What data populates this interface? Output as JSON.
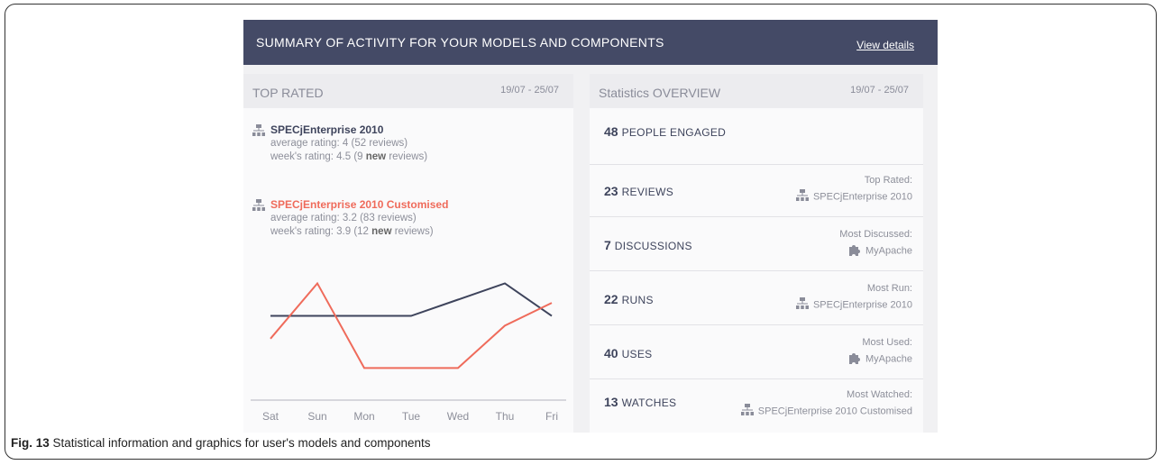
{
  "header": {
    "title": "SUMMARY OF ACTIVITY FOR YOUR MODELS AND COMPONENTS",
    "details_link": "View details"
  },
  "top_rated": {
    "title": "TOP RATED",
    "date": "19/07 - 25/07",
    "items": [
      {
        "name": "SPECjEnterprise 2010",
        "avg": "average rating: 4   (52 reviews)",
        "week_pre": "week's rating: 4.5  (9 ",
        "week_bold": "new",
        "week_post": " reviews)",
        "color": "#3e445c"
      },
      {
        "name": "SPECjEnterprise 2010 Customised",
        "avg": "average rating: 3.2 (83 reviews)",
        "week_pre": "week's rating: 3.9  (12 ",
        "week_bold": "new",
        "week_post": " reviews)",
        "color": "#ef6b5b"
      }
    ]
  },
  "chart_data": {
    "type": "line",
    "categories": [
      "Sat",
      "Sun",
      "Mon",
      "Tue",
      "Wed",
      "Thu",
      "Fri"
    ],
    "series": [
      {
        "name": "SPECjEnterprise 2010",
        "color": "#3e445c",
        "values": [
          3.6,
          3.6,
          3.6,
          3.6,
          4.1,
          4.6,
          3.6
        ]
      },
      {
        "name": "SPECjEnterprise 2010 Customised",
        "color": "#ef6b5b",
        "values": [
          2.9,
          4.6,
          2.0,
          2.0,
          2.0,
          3.3,
          4.0
        ]
      }
    ],
    "ylim": [
      1.4,
      5.0
    ]
  },
  "stats": {
    "title": "Statistics OVERVIEW",
    "date": "19/07 - 25/07",
    "rows": [
      {
        "count": "48",
        "label": "PEOPLE ENGAGED",
        "caption": "",
        "target": "",
        "icon": ""
      },
      {
        "count": "23",
        "label": "REVIEWS",
        "caption": "Top Rated:",
        "target": "SPECjEnterprise 2010",
        "icon": "network-icon"
      },
      {
        "count": "7",
        "label": "DISCUSSIONS",
        "caption": "Most Discussed:",
        "target": "MyApache",
        "icon": "puzzle-icon"
      },
      {
        "count": "22",
        "label": "RUNS",
        "caption": "Most Run:",
        "target": "SPECjEnterprise 2010",
        "icon": "network-icon"
      },
      {
        "count": "40",
        "label": "USES",
        "caption": "Most Used:",
        "target": "MyApache",
        "icon": "puzzle-icon"
      },
      {
        "count": "13",
        "label": "WATCHES",
        "caption": "Most Watched:",
        "target": "SPECjEnterprise 2010 Customised",
        "icon": "network-icon"
      }
    ]
  },
  "caption": {
    "fig": "Fig. 13",
    "text": " Statistical information and graphics for user's models and components"
  }
}
